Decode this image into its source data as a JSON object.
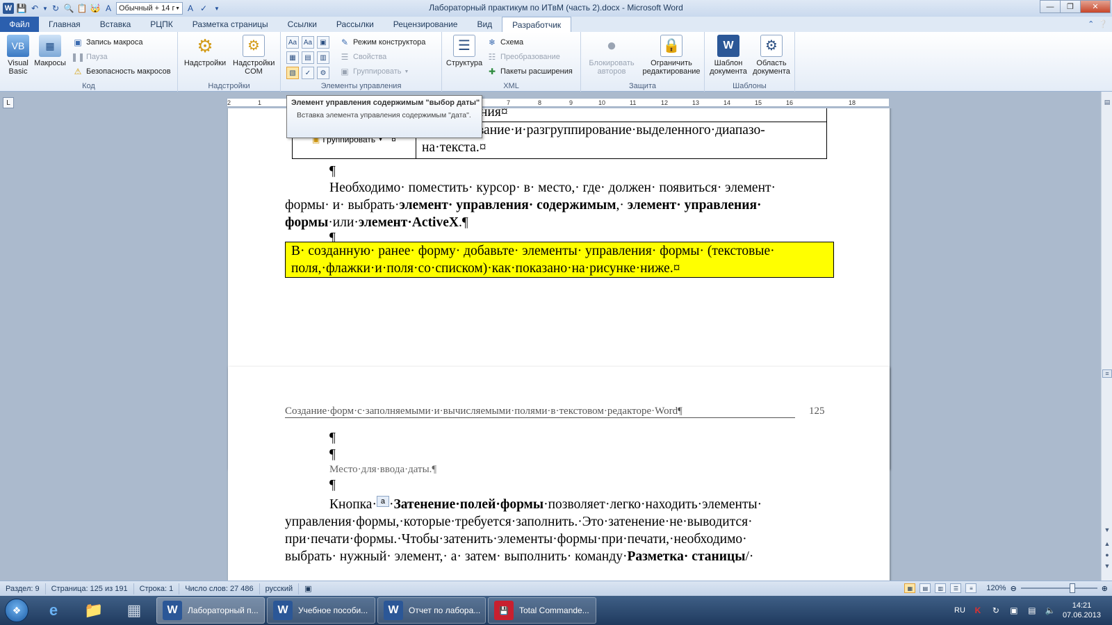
{
  "window": {
    "title": "Лабораторный практикум по ИТвМ (часть 2).docx - Microsoft Word",
    "style_box": "Обычный + 14 г"
  },
  "tabs": [
    {
      "label": "Файл"
    },
    {
      "label": "Главная"
    },
    {
      "label": "Вставка"
    },
    {
      "label": "РЦПК"
    },
    {
      "label": "Разметка страницы"
    },
    {
      "label": "Ссылки"
    },
    {
      "label": "Рассылки"
    },
    {
      "label": "Рецензирование"
    },
    {
      "label": "Вид"
    },
    {
      "label": "Разработчик"
    }
  ],
  "ribbon": {
    "code": {
      "label": "Код",
      "visual_basic": "Visual Basic",
      "macros": "Макросы",
      "record_macro": "Запись макроса",
      "pause": "Пауза",
      "macro_security": "Безопасность макросов"
    },
    "addins": {
      "label": "Надстройки",
      "addins": "Надстройки",
      "com_addins": "Надстройки COM"
    },
    "controls": {
      "label": "Элементы управления",
      "design_mode": "Режим конструктора",
      "properties": "Свойства",
      "group": "Группировать"
    },
    "xml": {
      "label": "XML",
      "structure": "Структура",
      "schema": "Схема",
      "transform": "Преобразование",
      "expansion_packs": "Пакеты расширения"
    },
    "protect": {
      "label": "Защита",
      "block_authors": "Блокировать авторов",
      "restrict_editing": "Ограничить редактирование"
    },
    "templates": {
      "label": "Шаблоны",
      "doc_template": "Шаблон документа",
      "doc_panel": "Область документа"
    }
  },
  "tooltip": {
    "title": "Элемент управления содержимым \"выбор даты\"",
    "body": "Вставка элемента управления содержимым \"дата\"."
  },
  "ruler": {
    "ticks": [
      "2",
      "1",
      "1",
      "2",
      "3",
      "4",
      "5",
      "6",
      "7",
      "8",
      "9",
      "10",
      "11",
      "12",
      "13",
      "14",
      "15",
      "16",
      "18"
    ]
  },
  "page1": {
    "table_row1_text": "ния¤",
    "table_row2_text_a": "Группирование·и·разгруппирование·выделенного·диапазо-",
    "table_row2_text_b": "на·текста.¤",
    "inline_button": "Группировать",
    "cell_mark": "¤",
    "pilcrow": "¶",
    "para1_line1": "Необходимо· поместить· курсор· в· место,· где· должен· появиться· элемент·",
    "para1_line2_a": "формы· и· выбрать·",
    "para1_line2_b": "элемент· управления· содержимым",
    "para1_line2_c": ",· ",
    "para1_line2_d": "элемент· управления·",
    "para1_line3_a": "формы",
    "para1_line3_b": "·или·",
    "para1_line3_c": "элемент·ActiveX",
    "para1_line3_d": ".¶",
    "yellow_line1": "В· созданную· ранее· форму· добавьте· элементы· управления· формы· (текстовые·",
    "yellow_line2": "поля,·флажки·и·поля·со·списком)·как·показано·на·рисунке·ниже.¤"
  },
  "page2": {
    "header_text": "Создание·форм·с·заполняемыми·и·вычисляемыми·полями·в·текстовом·редакторе·Word¶",
    "page_number": "125",
    "date_placeholder": "Место·для·ввода·даты.¶",
    "para_line1_a": "Кнопка·",
    "para_line1_b": "·",
    "para_line1_c": "Затенение·полей·формы",
    "para_line1_d": "·позволяет·легко·находить·элементы·",
    "para_line2": "управления·формы,·которые·требуется·заполнить.·Это·затенение·не·выводится·",
    "para_line3": "при·печати·формы.·Чтобы·затенить·элементы·формы·при·печати,·необходимо·",
    "para_line4_a": "выбрать·  нужный·  элемент,·  а·  затем·  выполнить·  команду·",
    "para_line4_b": "Разметка·  станицы",
    "para_line4_c": "/·"
  },
  "status": {
    "section": "Раздел: 9",
    "page": "Страница: 125 из 191",
    "line": "Строка: 1",
    "words": "Число слов: 27 486",
    "lang": "русский",
    "zoom": "120%"
  },
  "taskbar": {
    "tasks": [
      {
        "label": "Лабораторный п..."
      },
      {
        "label": "Учебное пособи..."
      },
      {
        "label": "Отчет по лабора..."
      },
      {
        "label": "Total Commande..."
      }
    ],
    "lang": "RU",
    "time": "14:21",
    "date": "07.06.2013"
  }
}
